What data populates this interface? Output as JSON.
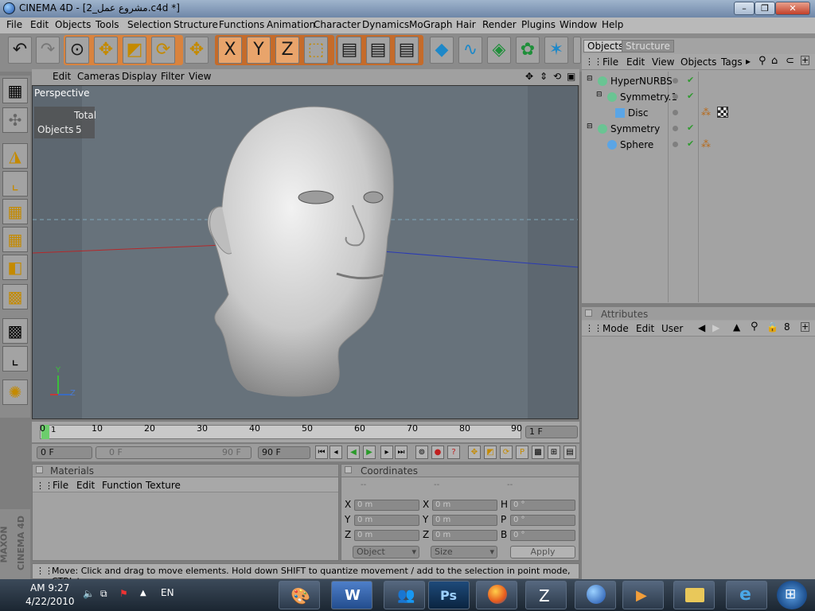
{
  "window": {
    "title": "CINEMA 4D - [2_مشروع عمل.c4d *]"
  },
  "menu": [
    "File",
    "Edit",
    "Objects",
    "Tools",
    "Selection",
    "Structure",
    "Functions",
    "Animation",
    "Character",
    "Dynamics",
    "MoGraph",
    "Hair",
    "Render",
    "Plugins",
    "Window",
    "Help"
  ],
  "toolbar": {
    "icons": [
      "undo-icon",
      "redo-icon",
      "select-icon",
      "move-icon",
      "scale-icon",
      "rotate-icon",
      "move-active-icon",
      "x-axis-icon",
      "y-axis-icon",
      "z-axis-icon",
      "coordinate-system-icon",
      "render-view-icon",
      "render-picture-viewer-icon",
      "render-settings-icon",
      "cube-icon",
      "spline-icon",
      "nurbs-icon",
      "array-icon",
      "deformer-icon",
      "camera-icon"
    ],
    "axis_labels": [
      "X",
      "Y",
      "Z"
    ]
  },
  "left_tools": [
    "model-mode-icon",
    "object-mode-icon",
    "axis-mode-icon",
    "points-mode-icon",
    "edges-mode-icon",
    "polygons-mode-icon",
    "uvw-points-icon",
    "uvw-polygons-icon",
    "texture-mode-icon",
    "texture-axis-icon",
    "paint-mode-icon"
  ],
  "viewport": {
    "menus": [
      "Edit",
      "Cameras",
      "Display",
      "Filter",
      "View"
    ],
    "label": "Perspective",
    "hud": {
      "total_label": "Total",
      "objects_label": "Objects",
      "objects_value": "5"
    },
    "axes": {
      "y": "Y",
      "z": "Z"
    }
  },
  "timeline": {
    "ticks": [
      "0",
      "10",
      "20",
      "30",
      "40",
      "50",
      "60",
      "70",
      "80",
      "90"
    ],
    "current_frame": "1 F",
    "playhead_label": "1"
  },
  "transport": {
    "start_field": "0 F",
    "range_left": "0 F",
    "range_right": "90 F",
    "end_field": "90 F"
  },
  "materials": {
    "title": "Materials",
    "menus": [
      "File",
      "Edit",
      "Function",
      "Texture"
    ]
  },
  "coordinates": {
    "title": "Coordinates",
    "col_headers": [
      "--",
      "--",
      "--"
    ],
    "rows": [
      {
        "l1": "X",
        "v1": "0 m",
        "l2": "X",
        "v2": "0 m",
        "l3": "H",
        "v3": "0 °"
      },
      {
        "l1": "Y",
        "v1": "0 m",
        "l2": "Y",
        "v2": "0 m",
        "l3": "P",
        "v3": "0 °"
      },
      {
        "l1": "Z",
        "v1": "0 m",
        "l2": "Z",
        "v2": "0 m",
        "l3": "B",
        "v3": "0 °"
      }
    ],
    "dropdown_object": "Object",
    "dropdown_size": "Size",
    "apply_label": "Apply"
  },
  "status": "Move: Click and drag to move elements. Hold down SHIFT to quantize movement / add to the selection in point mode, CTRL to remove.",
  "branding": {
    "maxon": "MAXON",
    "product": "CINEMA 4D"
  },
  "objects_panel": {
    "tabs": [
      "Objects",
      "Structure"
    ],
    "menus": [
      "File",
      "Edit",
      "View",
      "Objects",
      "Tags"
    ],
    "items": [
      {
        "name": "HyperNURBS",
        "indent": 0,
        "color": "#7fd1a6",
        "tags": []
      },
      {
        "name": "Symmetry.1",
        "indent": 1,
        "color": "#7fd1a6",
        "tags": []
      },
      {
        "name": "Disc",
        "indent": 2,
        "color": "#5aa5e6",
        "tags": [
          "phong-tag-icon",
          "texture-tag-icon"
        ]
      },
      {
        "name": "Symmetry",
        "indent": 0,
        "color": "#7fd1a6",
        "tags": []
      },
      {
        "name": "Sphere",
        "indent": 1,
        "color": "#5aa5e6",
        "tags": [
          "phong-tag-icon"
        ]
      }
    ]
  },
  "attributes_panel": {
    "title": "Attributes",
    "menus": [
      "Mode",
      "Edit",
      "User"
    ]
  },
  "taskbar": {
    "time": "AM 9:27",
    "date": "4/22/2010",
    "language": "EN",
    "apps": [
      "paint-app-icon",
      "word-app-icon",
      "messenger-app-icon",
      "photoshop-app-icon",
      "firefox-app-icon",
      "zbrush-app-icon",
      "cinema4d-app-icon",
      "media-app-icon",
      "explorer-folder-icon",
      "internet-explorer-icon"
    ],
    "photoshop_label": "Ps"
  }
}
